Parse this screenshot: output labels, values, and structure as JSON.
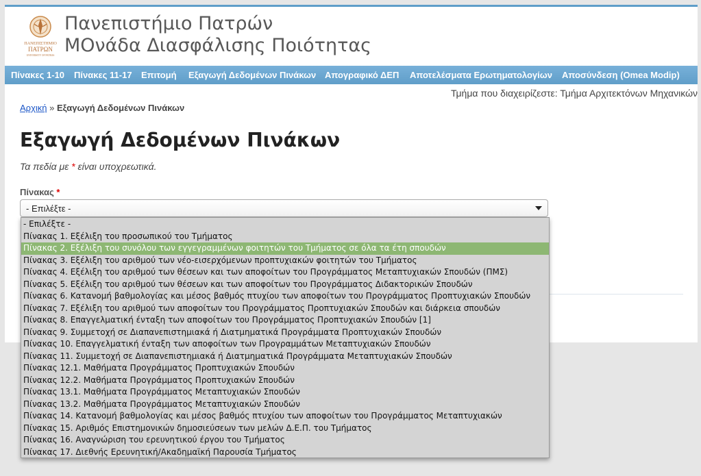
{
  "header": {
    "site_name_line1": "Πανεπιστήμιο Πατρών",
    "site_name_line2": "ΜΟνάδα Διασφάλισης Ποιότητας",
    "logo_text_line1": "ΠΑΝΕΠΙΣΤΗΜΙΟ",
    "logo_text_line2": "ΠΑΤΡΩΝ",
    "logo_text_line3": "UNIVERSITY OF PATRAS"
  },
  "nav": {
    "items": [
      {
        "label": "Πίνακες 1-10"
      },
      {
        "label": "Πίνακες 11-17"
      },
      {
        "label": "Επιτομή"
      },
      {
        "label": "Εξαγωγή Δεδομένων Πινάκων"
      },
      {
        "label": "Απογραφικό ΔΕΠ"
      },
      {
        "label": "Αποτελέσματα Ερωτηματολογίων"
      },
      {
        "label": "Αποσύνδεση (Omea Modip)"
      }
    ]
  },
  "department_text": "Τμήμα που διαχειρίζεστε: Τμήμα Αρχιτεκτόνων Μηχανικών",
  "breadcrumb": {
    "home": "Αρχική",
    "separator": "»",
    "current": "Εξαγωγή Δεδομένων Πινάκων"
  },
  "page_title": "Εξαγωγή Δεδομένων Πινάκων",
  "required_note": {
    "before": "Τα πεδία με",
    "star": "*",
    "after": "είναι υποχρεωτικά."
  },
  "form": {
    "label": "Πίνακας",
    "required_mark": "*",
    "selected_value": "- Επιλέξτε -",
    "highlighted_index": 2,
    "options": [
      "- Επιλέξτε -",
      "Πίνακας 1. Εξέλιξη του προσωπικού του Τμήματος",
      "Πίνακας 2. Εξέλιξη του συνόλου των εγγεγραμμένων φοιτητών του Τμήματος σε όλα τα έτη σπουδών",
      "Πίνακας 3. Εξέλιξη του αριθμού των νέο-εισερχόμενων προπτυχιακών φοιτητών του Τμήματος",
      "Πίνακας 4. Εξέλιξη του αριθμού των θέσεων και των αποφοίτων του Προγράμματος Μεταπτυχιακών Σπουδών (ΠΜΣ)",
      "Πίνακας 5. Εξέλιξη του αριθμού των θέσεων και των αποφοίτων του Προγράμματος Διδακτορικών Σπουδών",
      "Πίνακας 6. Κατανομή βαθμολογίας και μέσος βαθμός πτυχίου των αποφοίτων του Προγράμματος Προπτυχιακών Σπουδών",
      "Πίνακας 7. Εξέλιξη του αριθμού των αποφοίτων του Προγράμματος Προπτυχιακών Σπουδών και διάρκεια σπουδών",
      "Πίνακας 8. Επαγγελματική ένταξη των αποφοίτων του Προγράμματος Προπτυχιακών Σπουδών [1]",
      "Πίνακας 9. Συμμετοχή σε Διαπανεπιστημιακά ή Διατμηματικά Προγράμματα Προπτυχιακών Σπουδών",
      "Πίνακας 10. Επαγγελματική ένταξη των αποφοίτων των Προγραμμάτων Μεταπτυχιακών Σπουδών",
      "Πίνακας 11. Συμμετοχή σε Διαπανεπιστημιακά ή Διατμηματικά Προγράμματα Μεταπτυχιακών Σπουδών",
      "Πίνακας 12.1. Μαθήματα Προγράμματος Προπτυχιακών Σπουδών",
      "Πίνακας 12.2. Μαθήματα Προγράμματος Προπτυχιακών Σπουδών",
      "Πίνακας 13.1. Μαθήματα Προγράμματος Μεταπτυχιακών Σπουδών",
      "Πίνακας 13.2. Μαθήματα Προγράμματος Μεταπτυχιακών Σπουδών",
      "Πίνακας 14. Κατανομή βαθμολογίας και μέσος βαθμός πτυχίου των αποφοίτων του Προγράμματος Μεταπτυχιακών",
      "Πίνακας 15. Αριθμός Επιστημονικών δημοσιεύσεων των μελών Δ.Ε.Π. του Τμήματος",
      "Πίνακας 16. Αναγνώριση του ερευνητικού έργου του Τμήματος",
      "Πίνακας 17. Διεθνής Ερευνητική/Ακαδημαϊκή Παρουσία Τμήματος"
    ]
  },
  "colors": {
    "nav_bar": "#6fa8dc",
    "highlight": "#8db773",
    "link": "#1a55c7",
    "required": "#dd0000"
  }
}
